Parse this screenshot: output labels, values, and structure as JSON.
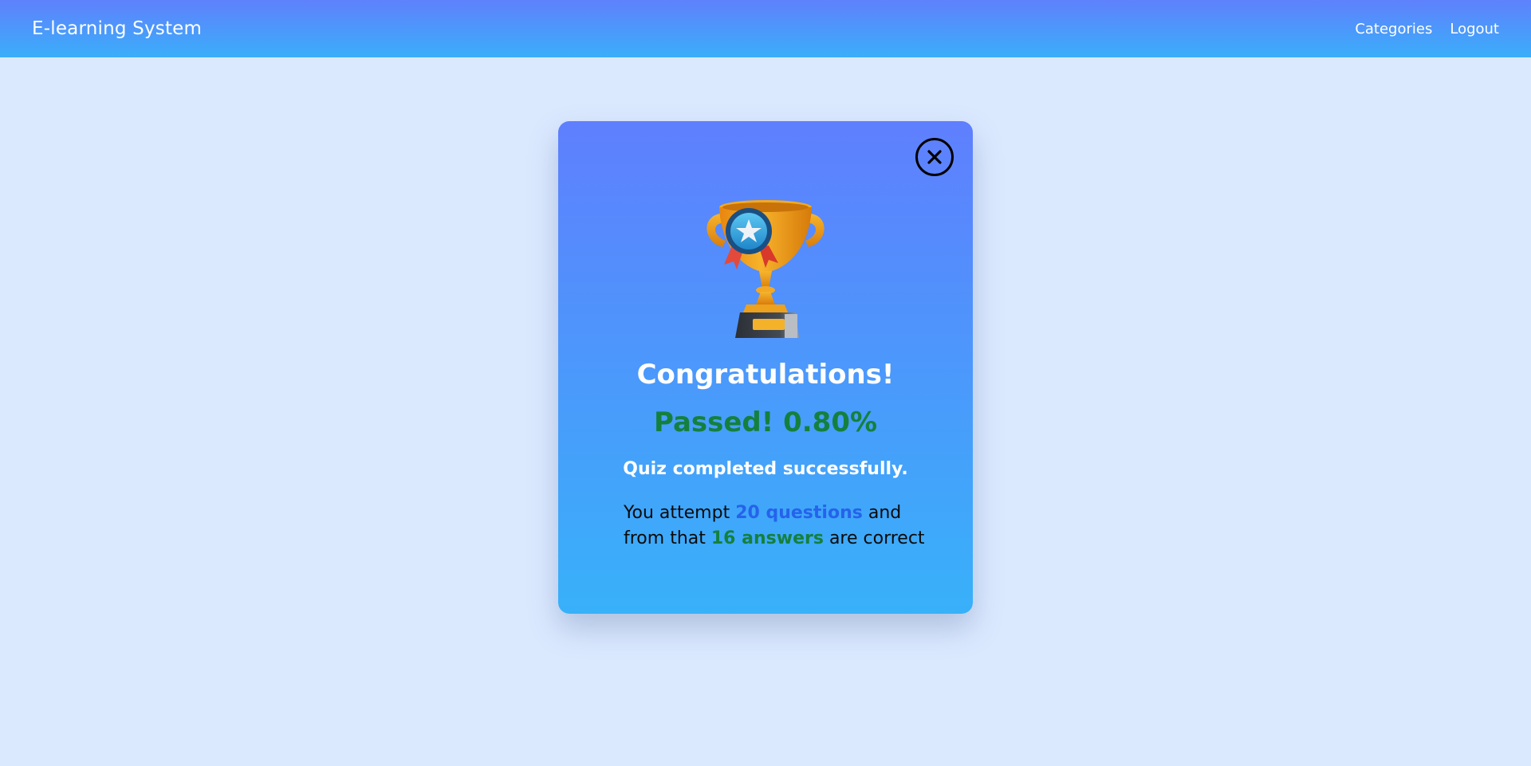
{
  "navbar": {
    "brand": "E-learning System",
    "links": [
      {
        "label": "Categories"
      },
      {
        "label": "Logout"
      }
    ]
  },
  "result_modal": {
    "close_icon": "close-circle-icon",
    "image": "trophy-icon",
    "title": "Congratulations!",
    "score_text": "Passed! 0.80%",
    "subtitle": "Quiz completed successfully.",
    "summary": {
      "prefix": "You attempt",
      "questions": "20 questions",
      "middle": "and from that",
      "answers": "16 answers",
      "suffix": "are correct"
    }
  },
  "colors": {
    "page_background": "#dbe9ff",
    "gradient_top": "#5f7ffe",
    "gradient_bottom": "#38b1f9",
    "pass_green": "#15803d",
    "highlight_blue": "#2563eb"
  }
}
